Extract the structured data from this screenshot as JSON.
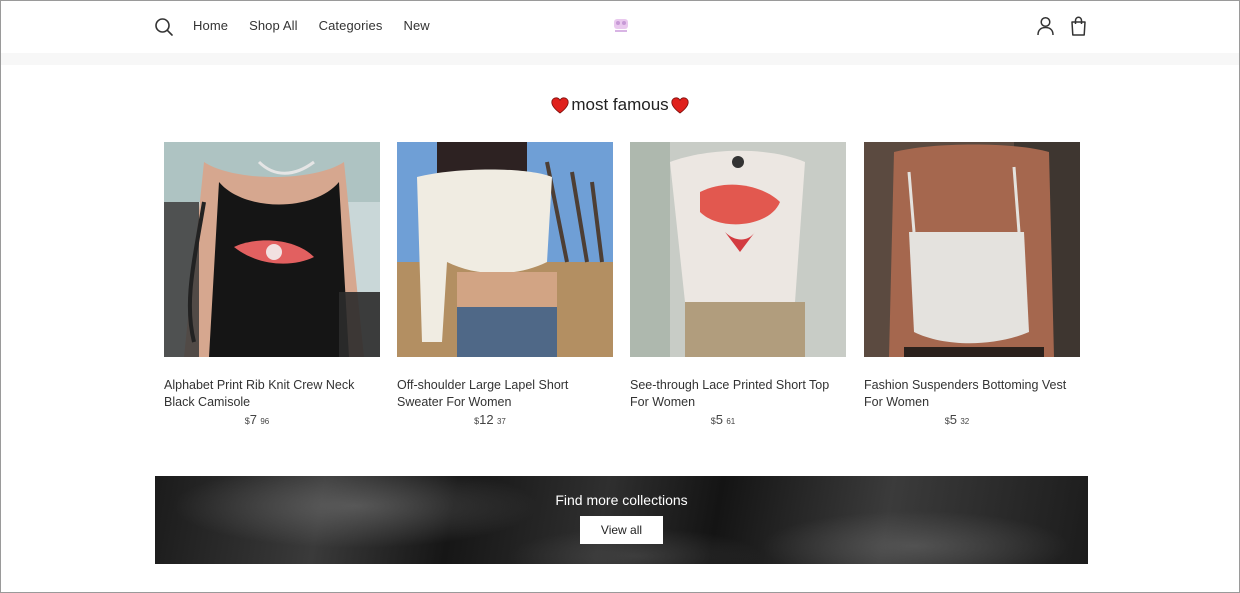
{
  "nav": {
    "items": [
      {
        "label": "Home"
      },
      {
        "label": "Shop All"
      },
      {
        "label": "Categories"
      },
      {
        "label": "New"
      }
    ]
  },
  "icons": {
    "search": "search-icon",
    "account": "account-icon",
    "cart": "cart-icon",
    "heart": "heart-icon"
  },
  "section": {
    "title": "most famous"
  },
  "products": [
    {
      "name": "Alphabet Print Rib Knit Crew Neck Black Camisole",
      "currency": "$",
      "price_whole": "7",
      "price_cents": "96"
    },
    {
      "name": "Off-shoulder Large Lapel Short Sweater For Women",
      "currency": "$",
      "price_whole": "12",
      "price_cents": "37"
    },
    {
      "name": "See-through Lace Printed Short Top For Women",
      "currency": "$",
      "price_whole": "5",
      "price_cents": "61"
    },
    {
      "name": "Fashion Suspenders Bottoming Vest For Women",
      "currency": "$",
      "price_whole": "5",
      "price_cents": "32"
    }
  ],
  "banner": {
    "title": "Find more collections",
    "button_label": "View all"
  },
  "colors": {
    "heart": "#e0201c",
    "banner_text": "#ffffff"
  }
}
